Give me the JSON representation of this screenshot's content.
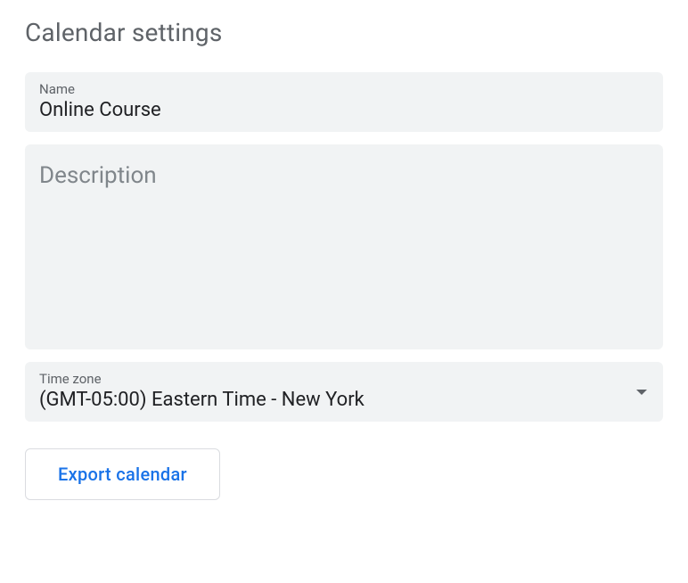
{
  "page": {
    "title": "Calendar settings"
  },
  "fields": {
    "name": {
      "label": "Name",
      "value": "Online Course"
    },
    "description": {
      "placeholder": "Description",
      "value": ""
    },
    "timezone": {
      "label": "Time zone",
      "value": "(GMT-05:00) Eastern Time - New York"
    }
  },
  "buttons": {
    "export": "Export calendar"
  }
}
